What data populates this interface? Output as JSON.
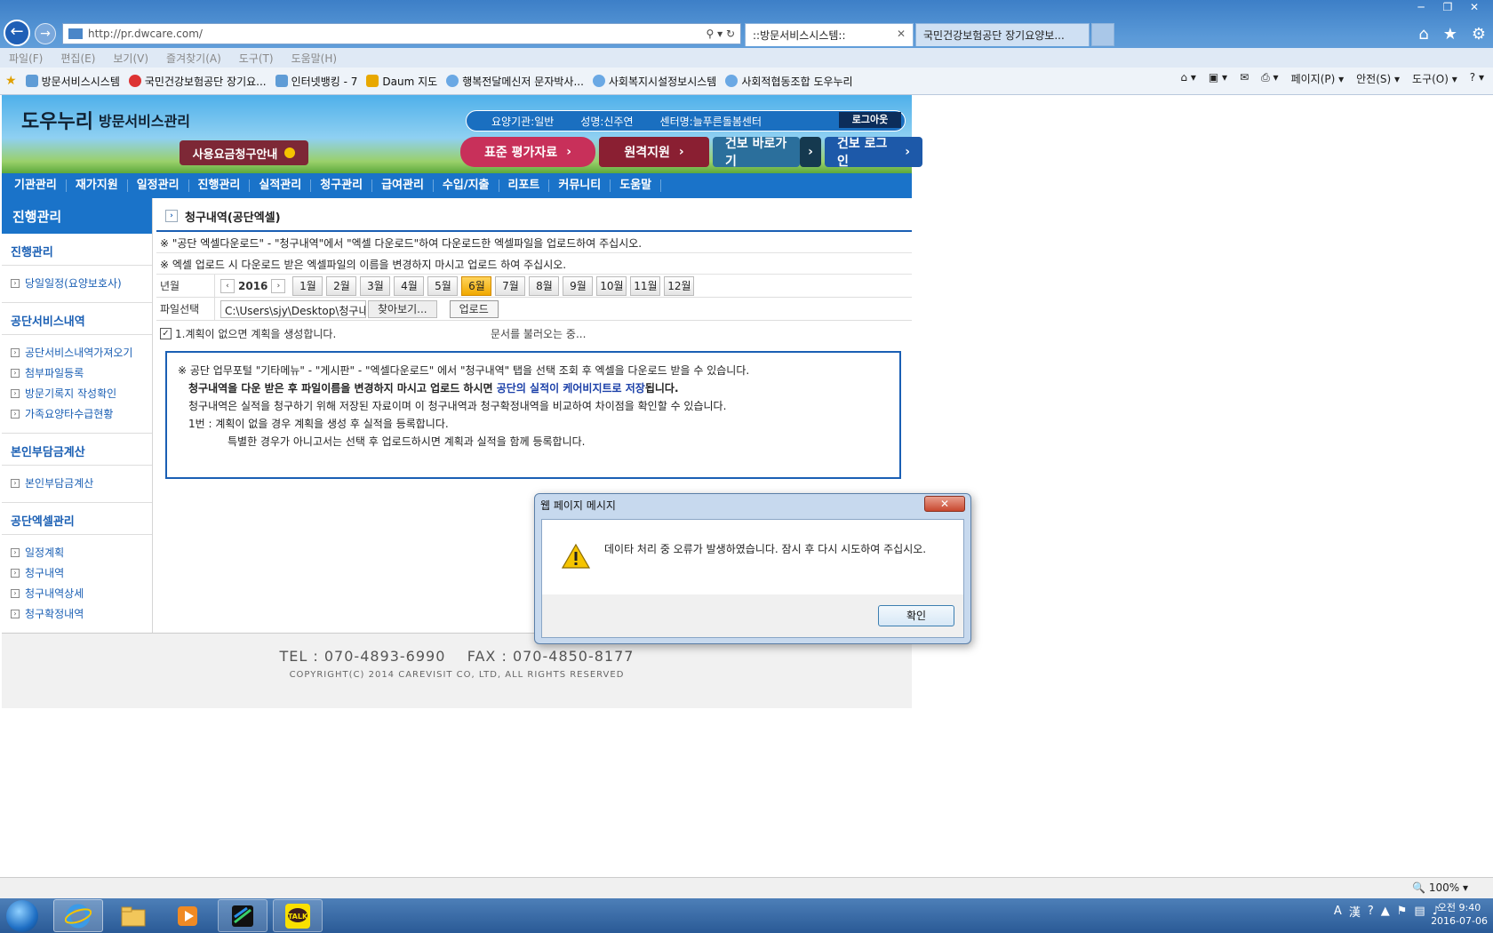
{
  "window": {
    "minimize": "─",
    "restore": "❐",
    "close": "✕"
  },
  "address": {
    "url": "http://pr.dwcare.com/",
    "tools": "⚲ ▾ ↻"
  },
  "tabs": [
    {
      "label": "::방문서비스시스템::",
      "close": "✕"
    },
    {
      "label": "국민건강보험공단 장기요양보..."
    }
  ],
  "menubar": [
    "파일(F)",
    "편집(E)",
    "보기(V)",
    "즐겨찾기(A)",
    "도구(T)",
    "도움말(H)"
  ],
  "favorites": [
    "방문서비스시스템",
    "국민건강보험공단 장기요...",
    "인터넷뱅킹 - 7",
    "Daum 지도",
    "행복전달메신저 문자박사...",
    "사회복지시설정보시스템",
    "사회적협동조합 도우누리"
  ],
  "commands": [
    "페이지(P) ▾",
    "안전(S) ▾",
    "도구(O) ▾",
    "? ▾"
  ],
  "site": {
    "brand": "도우누리",
    "brand_sub": "방문서비스관리",
    "fee_button": "사용요금청구안내",
    "info": {
      "org": "요양기관:일반",
      "name": "성명:신주연",
      "center": "센터명:늘푸른돌봄센터"
    },
    "logout": "로그아웃",
    "buttons": {
      "b1": "표준 평가자료",
      "b2": "원격지원",
      "b3": "건보 바로가기",
      "b4": "건보 로그인"
    },
    "mainmenu": [
      "기관관리",
      "재가지원",
      "일정관리",
      "진행관리",
      "실적관리",
      "청구관리",
      "급여관리",
      "수입/지출",
      "리포트",
      "커뮤니티",
      "도움말"
    ]
  },
  "lnb": {
    "title": "진행관리",
    "sections": [
      {
        "title": "진행관리",
        "items": [
          "당일일정(요양보호사)"
        ]
      },
      {
        "title": "공단서비스내역",
        "items": [
          "공단서비스내역가져오기",
          "첨부파일등록",
          "방문기록지 작성확인",
          "가족요양타수급현황"
        ]
      },
      {
        "title": "본인부담금계산",
        "items": [
          "본인부담금계산"
        ]
      },
      {
        "title": "공단엑셀관리",
        "items": [
          "일정계획",
          "청구내역",
          "청구내역상세",
          "청구확정내역"
        ]
      }
    ]
  },
  "content": {
    "title": "청구내역(공단엑셀)",
    "note1": "※ \"공단 엑셀다운로드\" - \"청구내역\"에서 \"엑셀 다운로드\"하여 다운로드한 엑셀파일을 업로드하여 주십시오.",
    "note2": "※ 엑셀 업로드 시 다운로드 받은 엑셀파일의 이름을 변경하지 마시고 업로드 하여 주십시오.",
    "year_label": "년월",
    "year": "2016",
    "months": [
      "1월",
      "2월",
      "3월",
      "4월",
      "5월",
      "6월",
      "7월",
      "8월",
      "9월",
      "10월",
      "11월",
      "12월"
    ],
    "selected_month": "6월",
    "file_label": "파일선택",
    "file_path": "C:\\Users\\sjy\\Desktop\\청구내역",
    "browse": "찾아보기...",
    "upload": "업로드",
    "checkbox": "1.계획이 없으면 계획을 생성합니다.",
    "loading": "문서를 불러오는 중...",
    "info_line1": "※ 공단 업무포털 \"기타메뉴\" - \"게시판\" - \"엑셀다운로드\" 에서 \"청구내역\" 탭을 선택 조회 후 엑셀을 다운로드 받을 수 있습니다.",
    "info_line2a": "청구내역을 다운 받은 후 파일이름을 변경하지 마시고 업로드 하시면 ",
    "info_line2b": "공단의 실적이 케어비지트로 저장",
    "info_line2c": "됩니다.",
    "info_line3": "청구내역은 실적을 청구하기 위해 저장된 자료이며 이 청구내역과 청구확정내역을 비교하여 차이점을 확인할 수 있습니다.",
    "info_line4": "1번 : 계획이 없을 경우 계획을 생성 후 실적을 등록합니다.",
    "info_line5": "특별한 경우가 아니고서는 선택 후 업로드하시면 계획과 실적을 함께 등록합니다."
  },
  "footer": {
    "tel": "TEL : 070-4893-6990    FAX : 070-4850-8177",
    "copyright": "COPYRIGHT(C) 2014 CAREVISIT CO, LTD, ALL RIGHTS RESERVED"
  },
  "dialog": {
    "title": "웹 페이지 메시지",
    "close": "✕",
    "message": "데이타 처리 중 오류가 발생하였습니다. 잠시 후 다시 시도하여 주십시오.",
    "ok": "확인"
  },
  "status": {
    "zoom": "🔍 100%  ▾"
  },
  "taskbar": {
    "time": "오전 9:40",
    "date": "2016-07-06",
    "talk": "TALK"
  },
  "colors": {
    "accent": "#1a73c9",
    "selected_month": "#f0a800",
    "dialog_frame": "#c7d9ee"
  }
}
